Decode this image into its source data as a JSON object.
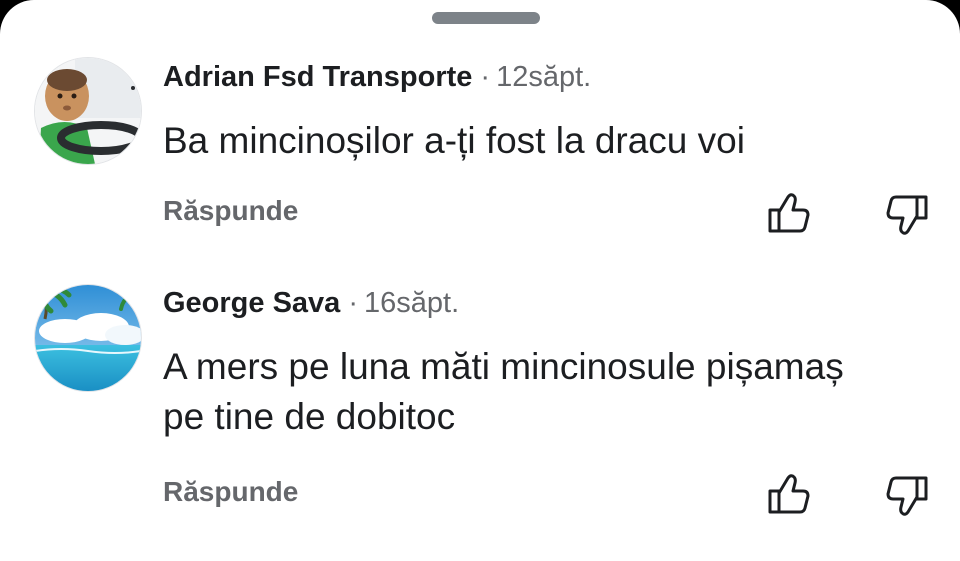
{
  "comments": [
    {
      "author": "Adrian Fsd Transporte",
      "time": "12săpt.",
      "text": "Ba mincinoșilor a-ți fost la dracu voi",
      "reply_label": "Răspunde",
      "avatar_icon": "child-driving-avatar",
      "upvote_icon": "thumbs-up-outline-icon",
      "downvote_icon": "thumbs-down-outline-icon"
    },
    {
      "author": "George Sava",
      "time": "16săpt.",
      "text": "A mers pe luna măti mincinosule pișamaș pe tine de dobitoc",
      "reply_label": "Răspunde",
      "avatar_icon": "beach-palm-avatar",
      "upvote_icon": "thumbs-up-outline-icon",
      "downvote_icon": "thumbs-down-outline-icon"
    }
  ],
  "separator": "·",
  "colors": {
    "text_primary": "#1c1e21",
    "text_secondary": "#65676b",
    "background": "#ffffff",
    "handle": "#7d8389"
  }
}
